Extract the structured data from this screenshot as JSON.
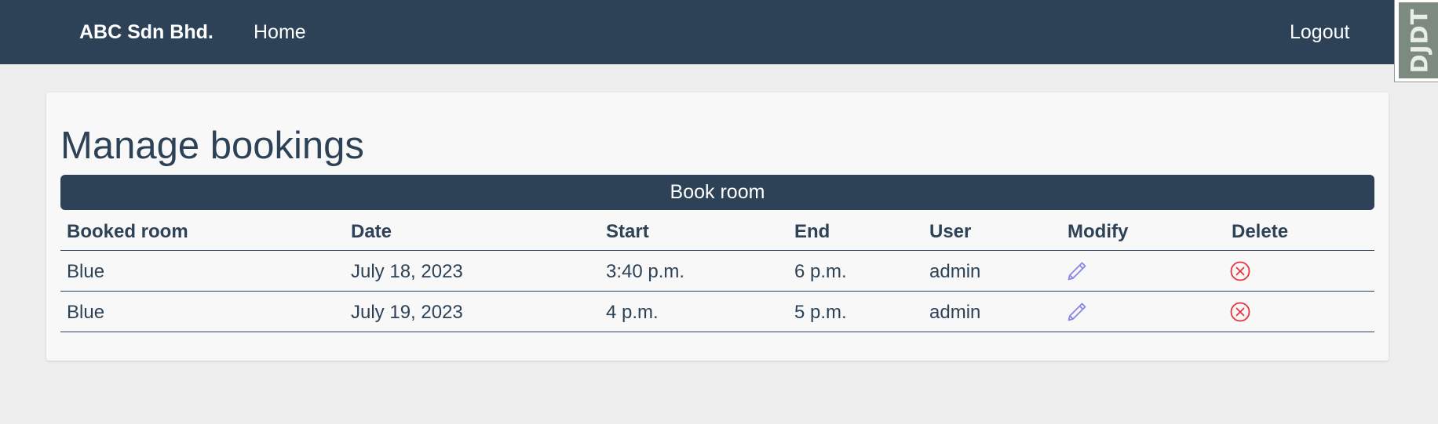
{
  "navbar": {
    "brand": "ABC Sdn Bhd.",
    "home_label": "Home",
    "logout_label": "Logout"
  },
  "debug_toolbar": {
    "label": "DJDT"
  },
  "page": {
    "title": "Manage bookings",
    "book_button_label": "Book room"
  },
  "table": {
    "headers": [
      "Booked room",
      "Date",
      "Start",
      "End",
      "User",
      "Modify",
      "Delete"
    ],
    "rows": [
      {
        "room": "Blue",
        "date": "July 18, 2023",
        "start": "3:40 p.m.",
        "end": "6 p.m.",
        "user": "admin",
        "modify_icon": "pencil-icon",
        "delete_icon": "circle-x-icon"
      },
      {
        "room": "Blue",
        "date": "July 19, 2023",
        "start": "4 p.m.",
        "end": "5 p.m.",
        "user": "admin",
        "modify_icon": "pencil-icon",
        "delete_icon": "circle-x-icon"
      }
    ]
  },
  "colors": {
    "navbar_bg": "#2d4256",
    "page_bg": "#eeeeee",
    "card_bg": "#f8f8f8",
    "edit_icon": "#8a86e8",
    "delete_icon": "#e8323c"
  }
}
